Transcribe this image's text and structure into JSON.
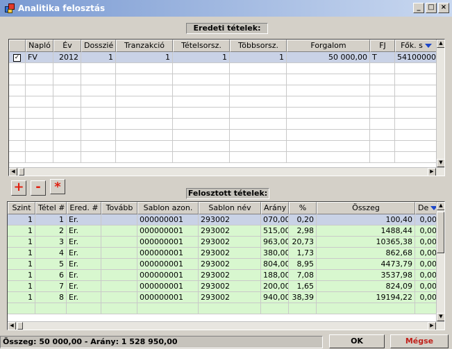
{
  "window": {
    "title": "Analitika felosztás",
    "buttons": [
      "_",
      "□",
      "×"
    ]
  },
  "original": {
    "caption": "Eredeti tételek:",
    "columns": [
      "",
      "Napló",
      "Év",
      "Dosszié",
      "Tranzakció",
      "Tételsorsz.",
      "Többsorsz.",
      "Forgalom",
      "FJ",
      "Fők. s"
    ],
    "row": {
      "checkbox": "✓",
      "naplo": "FV",
      "ev": "2012",
      "dosszie": "1",
      "tranzakcio": "1",
      "tetelsorsz": "1",
      "tobbsorsz": "1",
      "forgalom": "50 000,00",
      "fj": "T",
      "fok": "54100000"
    }
  },
  "toolbar": {
    "add": "+",
    "remove": "-",
    "star": "*"
  },
  "distributed": {
    "caption": "Felosztott tételek:",
    "columns": [
      "Szint",
      "Tétel #",
      "Ered. #",
      "Tovább",
      "Sablon azon.",
      "Sablon név",
      "Arány",
      "%",
      "Összeg",
      "De"
    ],
    "rows": [
      [
        "1",
        "1",
        "Er.",
        "",
        "000000001",
        "293002",
        "070,00",
        "0,20",
        "100,40",
        "0,00"
      ],
      [
        "1",
        "2",
        "Er.",
        "",
        "000000001",
        "293002",
        "515,00",
        "2,98",
        "1488,44",
        "0,00"
      ],
      [
        "1",
        "3",
        "Er.",
        "",
        "000000001",
        "293002",
        "963,00",
        "20,73",
        "10365,38",
        "0,00"
      ],
      [
        "1",
        "4",
        "Er.",
        "",
        "000000001",
        "293002",
        "380,00",
        "1,73",
        "862,68",
        "0,00"
      ],
      [
        "1",
        "5",
        "Er.",
        "",
        "000000001",
        "293002",
        "804,00",
        "8,95",
        "4473,79",
        "0,00"
      ],
      [
        "1",
        "6",
        "Er.",
        "",
        "000000001",
        "293002",
        "188,00",
        "7,08",
        "3537,98",
        "0,00"
      ],
      [
        "1",
        "7",
        "Er.",
        "",
        "000000001",
        "293002",
        "200,00",
        "1,65",
        "824,09",
        "0,00"
      ],
      [
        "1",
        "8",
        "Er.",
        "",
        "000000001",
        "293002",
        "940,00",
        "38,39",
        "19194,22",
        "0,00"
      ]
    ]
  },
  "status": {
    "text": "Összeg: 50 000,00 - Arány: 1 528 950,00"
  },
  "actions": {
    "ok": "OK",
    "cancel": "Mégse",
    "cancel_color": "#c0201a"
  }
}
